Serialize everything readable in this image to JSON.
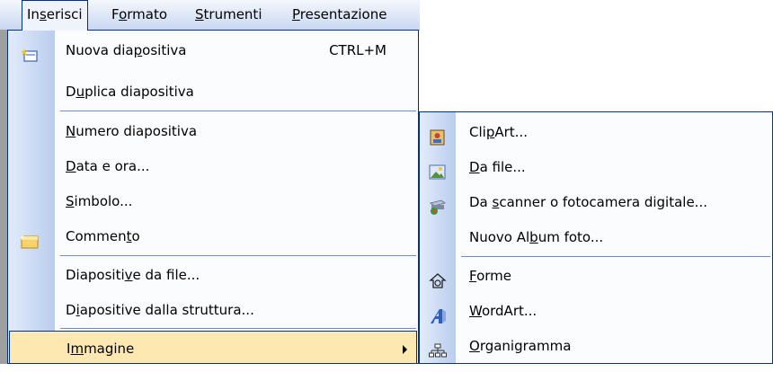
{
  "menubar": {
    "items": [
      {
        "pre": "In",
        "hot": "s",
        "post": "erisci"
      },
      {
        "pre": "F",
        "hot": "o",
        "post": "rmato"
      },
      {
        "pre": "",
        "hot": "S",
        "post": "trumenti"
      },
      {
        "pre": "",
        "hot": "P",
        "post": "resentazione"
      }
    ]
  },
  "menu": {
    "items": [
      {
        "pre": "Nuova dia",
        "hot": "p",
        "post": "ositiva",
        "shortcut": "CTRL+M",
        "icon": "new-slide-icon"
      },
      {
        "pre": "D",
        "hot": "u",
        "post": "plica diapositiva"
      },
      {
        "pre": "",
        "hot": "N",
        "post": "umero diapositiva"
      },
      {
        "pre": "",
        "hot": "D",
        "post": "ata e ora..."
      },
      {
        "pre": "",
        "hot": "S",
        "post": "imbolo..."
      },
      {
        "pre": "Commen",
        "hot": "t",
        "post": "o",
        "icon": "comment-icon"
      },
      {
        "pre": "Diapositi",
        "hot": "v",
        "post": "e da file..."
      },
      {
        "pre": "D",
        "hot": "i",
        "post": "apositive dalla struttura..."
      },
      {
        "pre": "I",
        "hot": "m",
        "post": "magine"
      }
    ]
  },
  "submenu": {
    "items": [
      {
        "pre": "Cli",
        "hot": "p",
        "post": "Art...",
        "icon": "clipart-icon"
      },
      {
        "pre": "",
        "hot": "D",
        "post": "a file...",
        "icon": "picture-file-icon"
      },
      {
        "pre": "Da ",
        "hot": "s",
        "post": "canner o fotocamera digitale...",
        "icon": "scanner-camera-icon"
      },
      {
        "pre": "Nuovo Al",
        "hot": "b",
        "post": "um foto..."
      },
      {
        "pre": "",
        "hot": "F",
        "post": "orme",
        "icon": "autoshapes-icon"
      },
      {
        "pre": "",
        "hot": "W",
        "post": "ordArt...",
        "icon": "wordart-icon"
      },
      {
        "pre": "",
        "hot": "O",
        "post": "rganigramma",
        "icon": "org-chart-icon"
      }
    ]
  },
  "colors": {
    "highlight": "#fde8b2",
    "border": "#002d96",
    "gutter": "#b9cdee"
  }
}
